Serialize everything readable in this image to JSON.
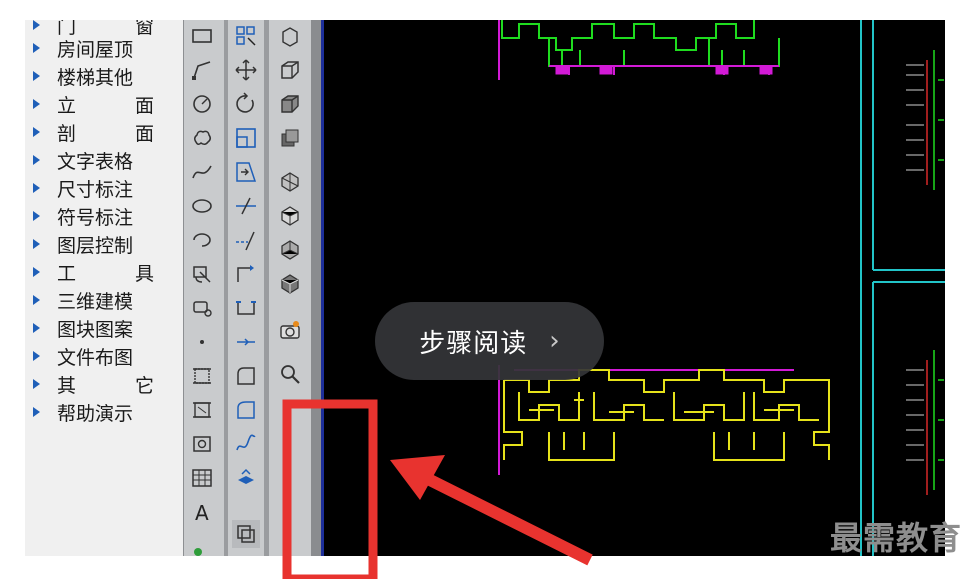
{
  "menu": {
    "items": [
      {
        "label": "门      窗",
        "partial": true
      },
      {
        "label": "房间屋顶"
      },
      {
        "label": "楼梯其他"
      },
      {
        "label": "立      面"
      },
      {
        "label": "剖      面"
      },
      {
        "label": "文字表格"
      },
      {
        "label": "尺寸标注"
      },
      {
        "label": "符号标注"
      },
      {
        "label": "图层控制"
      },
      {
        "label": "工      具"
      },
      {
        "label": "三维建模"
      },
      {
        "label": "图块图案"
      },
      {
        "label": "文件布图"
      },
      {
        "label": "其      它"
      },
      {
        "label": "帮助演示"
      }
    ]
  },
  "toolbar": {
    "col1": [
      "rectangle",
      "polyline",
      "circle",
      "cloud",
      "spline",
      "ellipse",
      "arc",
      "insert-block",
      "move-block",
      "point",
      "hatch-box",
      "hatch-alt",
      "camera-box",
      "table-grid",
      "text-A"
    ],
    "col2": [
      "grid-select",
      "move-arrows",
      "rotate",
      "scale-box",
      "stretch",
      "trim",
      "extend",
      "break",
      "join",
      "array",
      "fillet",
      "chamfer",
      "spline-edit",
      "3d-view"
    ],
    "col3": [
      "3d-box-top",
      "3d-box",
      "3d-box-2",
      "3d-box-3",
      "shade-1",
      "shade-2",
      "shade-3",
      "shade-4",
      "camera",
      "zoom"
    ]
  },
  "overlay": {
    "step_label": "步骤阅读",
    "chevron": "›"
  },
  "annotation": {
    "color": "#e8332f"
  },
  "colors": {
    "plan_green": "#1fdc1f",
    "plan_magenta": "#d21ad6",
    "plan_yellow": "#e6e21a",
    "plan_cyan": "#22c4c8"
  },
  "watermark": "最需教育"
}
